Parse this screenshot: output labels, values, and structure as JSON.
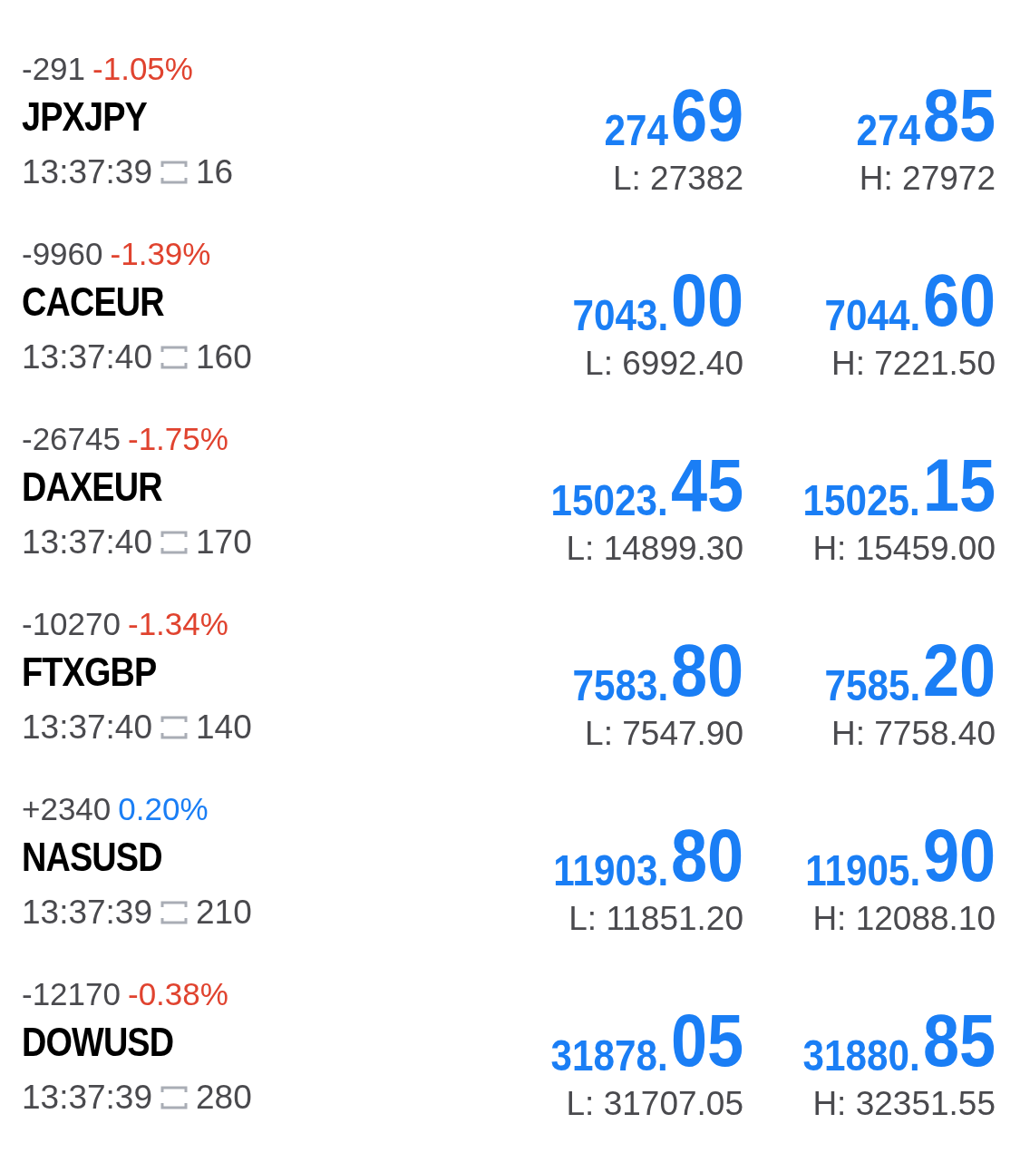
{
  "quotes": [
    {
      "change": "-291",
      "percent": "-1.05%",
      "color": "#e0432f",
      "symbol": "JPXJPY",
      "time": "13:37:39",
      "spread": "16",
      "bid": {
        "main": "274",
        "big": "69"
      },
      "ask": {
        "main": "274",
        "big": "85"
      },
      "low": "L: 27382",
      "high": "H: 27972"
    },
    {
      "change": "-9960",
      "percent": "-1.39%",
      "color": "#e0432f",
      "symbol": "CACEUR",
      "time": "13:37:40",
      "spread": "160",
      "bid": {
        "main": "7043.",
        "big": "00"
      },
      "ask": {
        "main": "7044.",
        "big": "60"
      },
      "low": "L: 6992.40",
      "high": "H: 7221.50"
    },
    {
      "change": "-26745",
      "percent": "-1.75%",
      "color": "#e0432f",
      "symbol": "DAXEUR",
      "time": "13:37:40",
      "spread": "170",
      "bid": {
        "main": "15023.",
        "big": "45"
      },
      "ask": {
        "main": "15025.",
        "big": "15"
      },
      "low": "L: 14899.30",
      "high": "H: 15459.00"
    },
    {
      "change": "-10270",
      "percent": "-1.34%",
      "color": "#e0432f",
      "symbol": "FTXGBP",
      "time": "13:37:40",
      "spread": "140",
      "bid": {
        "main": "7583.",
        "big": "80"
      },
      "ask": {
        "main": "7585.",
        "big": "20"
      },
      "low": "L: 7547.90",
      "high": "H: 7758.40"
    },
    {
      "change": "+2340",
      "percent": "0.20%",
      "color": "#1a7ef5",
      "symbol": "NASUSD",
      "time": "13:37:39",
      "spread": "210",
      "bid": {
        "main": "11903.",
        "big": "80"
      },
      "ask": {
        "main": "11905.",
        "big": "90"
      },
      "low": "L: 11851.20",
      "high": "H: 12088.10"
    },
    {
      "change": "-12170",
      "percent": "-0.38%",
      "color": "#e0432f",
      "symbol": "DOWUSD",
      "time": "13:37:39",
      "spread": "280",
      "bid": {
        "main": "31878.",
        "big": "05"
      },
      "ask": {
        "main": "31880.",
        "big": "85"
      },
      "low": "L: 31707.05",
      "high": "H: 32351.55"
    }
  ]
}
